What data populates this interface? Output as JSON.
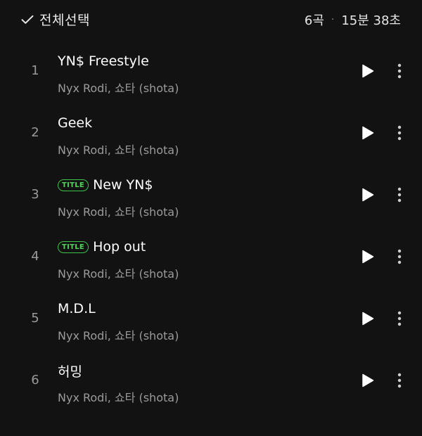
{
  "header": {
    "select_all_label": "전체선택",
    "track_count": "6곡",
    "separator": "·",
    "total_duration": "15분 38초"
  },
  "tracks": [
    {
      "number": "1",
      "title": "YN$ Freestyle",
      "artist": "Nyx Rodi, 쇼타 (shota)",
      "badge": ""
    },
    {
      "number": "2",
      "title": "Geek",
      "artist": "Nyx Rodi, 쇼타 (shota)",
      "badge": ""
    },
    {
      "number": "3",
      "title": "New YN$",
      "artist": "Nyx Rodi, 쇼타 (shota)",
      "badge": "TITLE"
    },
    {
      "number": "4",
      "title": "Hop out",
      "artist": "Nyx Rodi, 쇼타 (shota)",
      "badge": "TITLE"
    },
    {
      "number": "5",
      "title": "M.D.L",
      "artist": "Nyx Rodi, 쇼타 (shota)",
      "badge": ""
    },
    {
      "number": "6",
      "title": "허밍",
      "artist": "Nyx Rodi, 쇼타 (shota)",
      "badge": ""
    }
  ],
  "icons": {
    "select_all": "check-icon",
    "play": "play-icon",
    "more": "more-vertical-icon"
  },
  "colors": {
    "background": "#121212",
    "title_badge": "#52d35a",
    "secondary_text": "#9b9b9b"
  }
}
